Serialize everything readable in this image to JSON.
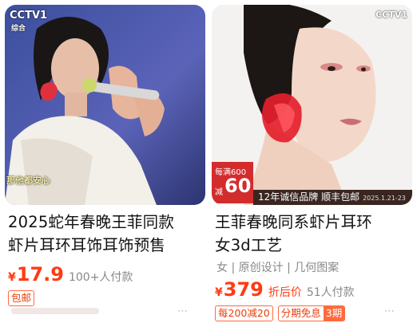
{
  "products": [
    {
      "title_lines": [
        "2025蛇年春晚王菲同款",
        "虾片耳环耳饰耳饰预售"
      ],
      "image_overlay": {
        "logo": "CCTV1",
        "logo_sub": "综合",
        "subtitle": "那他都安心"
      },
      "price_symbol": "¥",
      "price": "17.9",
      "buyers": "100+人付款",
      "badges": [
        "包邮"
      ],
      "more": "⋯"
    },
    {
      "title_lines": [
        "王菲春晚同系虾片耳环",
        "女3d工艺"
      ],
      "tags": "女 | 原创设计 | 几何图案",
      "image_overlay": {
        "logo": "CCTV1",
        "promo_small": "每满600",
        "promo_big": "60",
        "promo_yen": "减",
        "strip_text": "12年诚信品牌 顺丰包邮",
        "strip_date": "2025.1.21-23"
      },
      "price_symbol": "¥",
      "price": "379",
      "price_note": "折后价",
      "buyers": "51人付款",
      "badges": [
        "每200减20"
      ],
      "split_badge": {
        "left": "分期免息",
        "right": "3期"
      },
      "more": "⋯"
    }
  ],
  "colors": {
    "price": "#ff3b14",
    "muted": "#888888",
    "badge_border": "#ff6a3d"
  }
}
